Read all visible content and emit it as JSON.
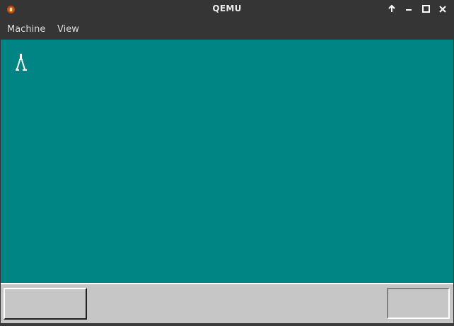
{
  "window": {
    "title": "QEMU",
    "app_icon": "qemu-icon",
    "controls": [
      "up-arrow-icon",
      "minimize-icon",
      "maximize-icon",
      "close-icon"
    ]
  },
  "menubar": {
    "items": [
      {
        "label": "Machine"
      },
      {
        "label": "View"
      }
    ]
  },
  "screen": {
    "background_color": "#008484",
    "glyph": "compass-cursor-icon"
  },
  "taskbar": {
    "background_color": "#c6c6c6",
    "start_button_label": "",
    "tray_text": ""
  }
}
